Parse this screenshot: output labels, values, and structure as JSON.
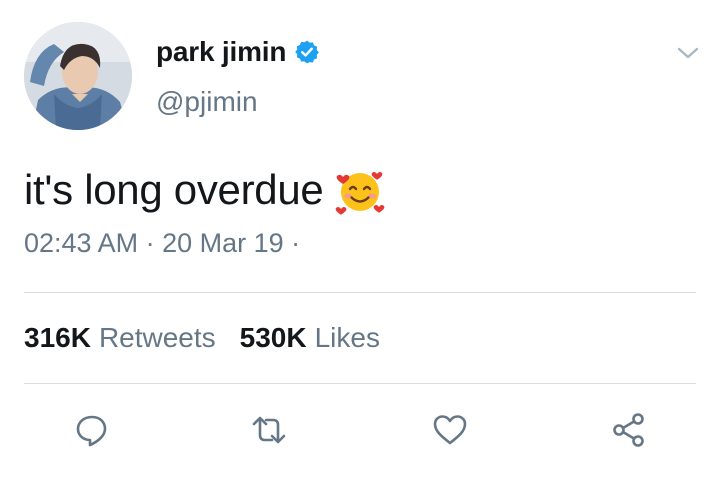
{
  "user": {
    "display_name": "park jimin",
    "handle": "@pjimin",
    "verified": true
  },
  "tweet": {
    "text": "it's long overdue",
    "emoji": "smiling-face-with-hearts",
    "timestamp": "02:43 AM · 20 Mar 19 ·"
  },
  "stats": {
    "retweets_count": "316K",
    "retweets_label": "Retweets",
    "likes_count": "530K",
    "likes_label": "Likes"
  },
  "icons": {
    "menu": "chevron-down-icon",
    "reply": "reply-icon",
    "retweet": "retweet-icon",
    "like": "heart-icon",
    "share": "share-icon"
  },
  "colors": {
    "verified": "#1da1f2",
    "secondary_text": "#657786",
    "icon": "#657786",
    "divider": "#d7dee3"
  }
}
